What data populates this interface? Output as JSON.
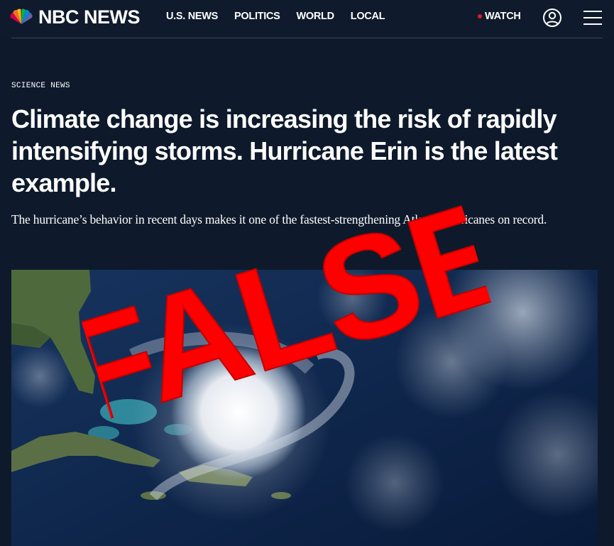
{
  "header": {
    "brand": "NBC NEWS",
    "nav_items": [
      {
        "label": "U.S. NEWS"
      },
      {
        "label": "POLITICS"
      },
      {
        "label": "WORLD"
      },
      {
        "label": "LOCAL"
      }
    ],
    "watch_label": "WATCH",
    "account_icon": "account-icon",
    "menu_icon": "hamburger-menu-icon",
    "live_dot_color": "#e51b23"
  },
  "article": {
    "kicker": "SCIENCE NEWS",
    "headline": "Climate change is increasing the risk of rapidly intensifying storms. Hurricane Erin is the latest example.",
    "dek": "The hurricane’s behavior in recent days makes it one of the fastest-strengthening Atlantic hurricanes on record."
  },
  "overlay": {
    "stamp_text": "FALSE",
    "stamp_color": "#ff0000"
  },
  "colors": {
    "background": "#0e1a2b"
  }
}
